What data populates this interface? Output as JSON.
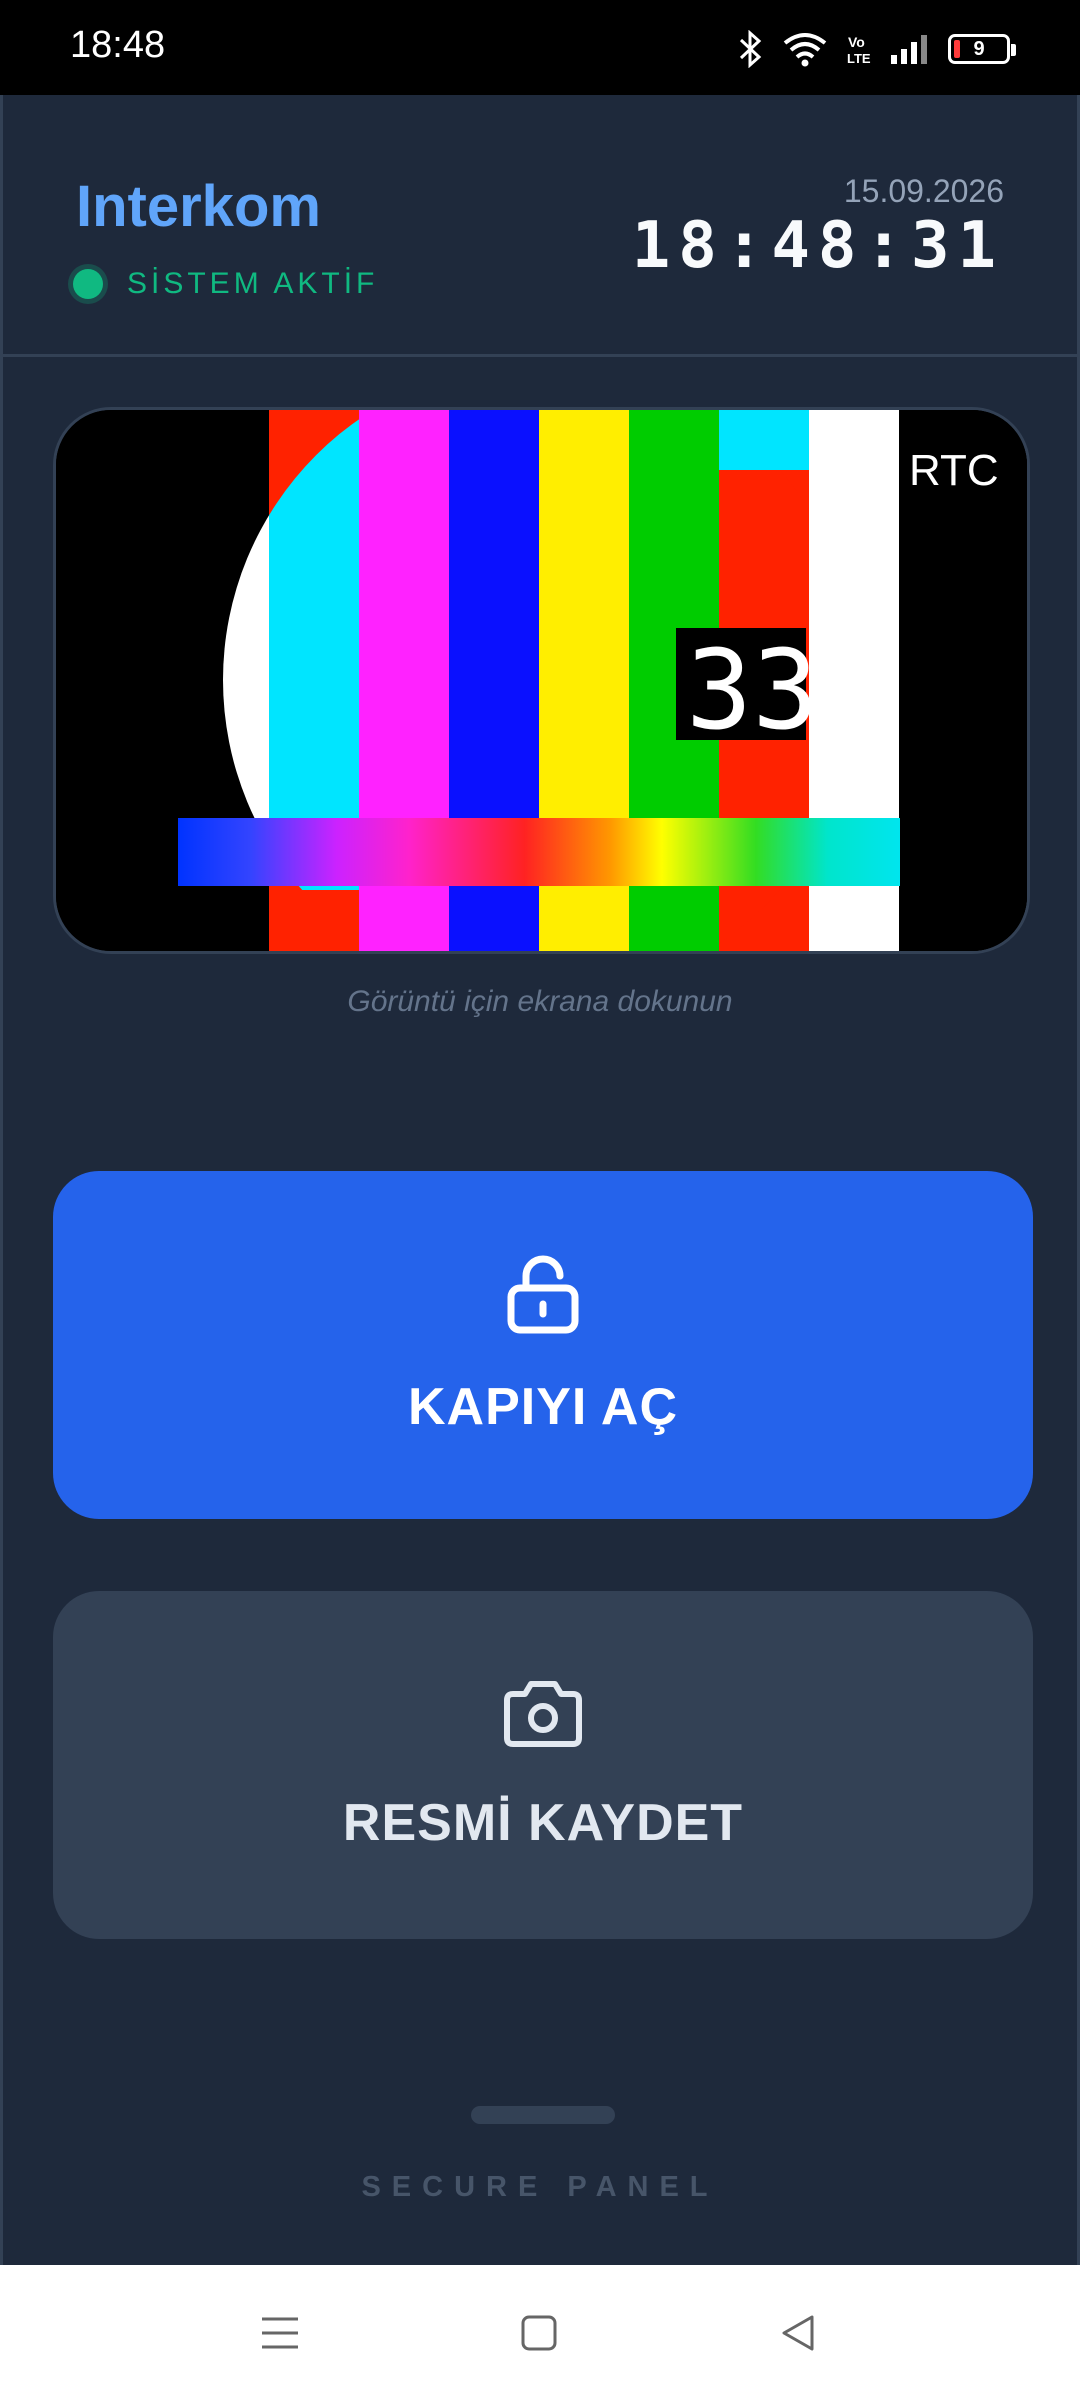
{
  "status_bar": {
    "time": "18:48",
    "battery": "9",
    "icons": [
      "bluetooth-icon",
      "wifi-icon",
      "volte-icon",
      "signal-icon",
      "battery-icon"
    ]
  },
  "header": {
    "title": "Interkom",
    "status_text": "SİSTEM AKTİF",
    "date": "15.09.2026",
    "clock": "18:48:31"
  },
  "video": {
    "overlay_label": "RTC",
    "overlay_counter": "33",
    "hint": "Görüntü için ekrana dokunun"
  },
  "actions": {
    "open_door_label": "KAPIYI AÇ",
    "open_door_icon": "unlock-icon",
    "save_image_label": "RESMİ KAYDET",
    "save_image_icon": "camera-icon"
  },
  "footer": {
    "label": "SECURE PANEL"
  },
  "nav": [
    "menu-icon",
    "home-icon",
    "back-icon"
  ],
  "colors": {
    "background": "#1e293b",
    "accent": "#2563eb",
    "title": "#60a5fa",
    "status_ok": "#10b981",
    "secondary_button": "#334155"
  }
}
